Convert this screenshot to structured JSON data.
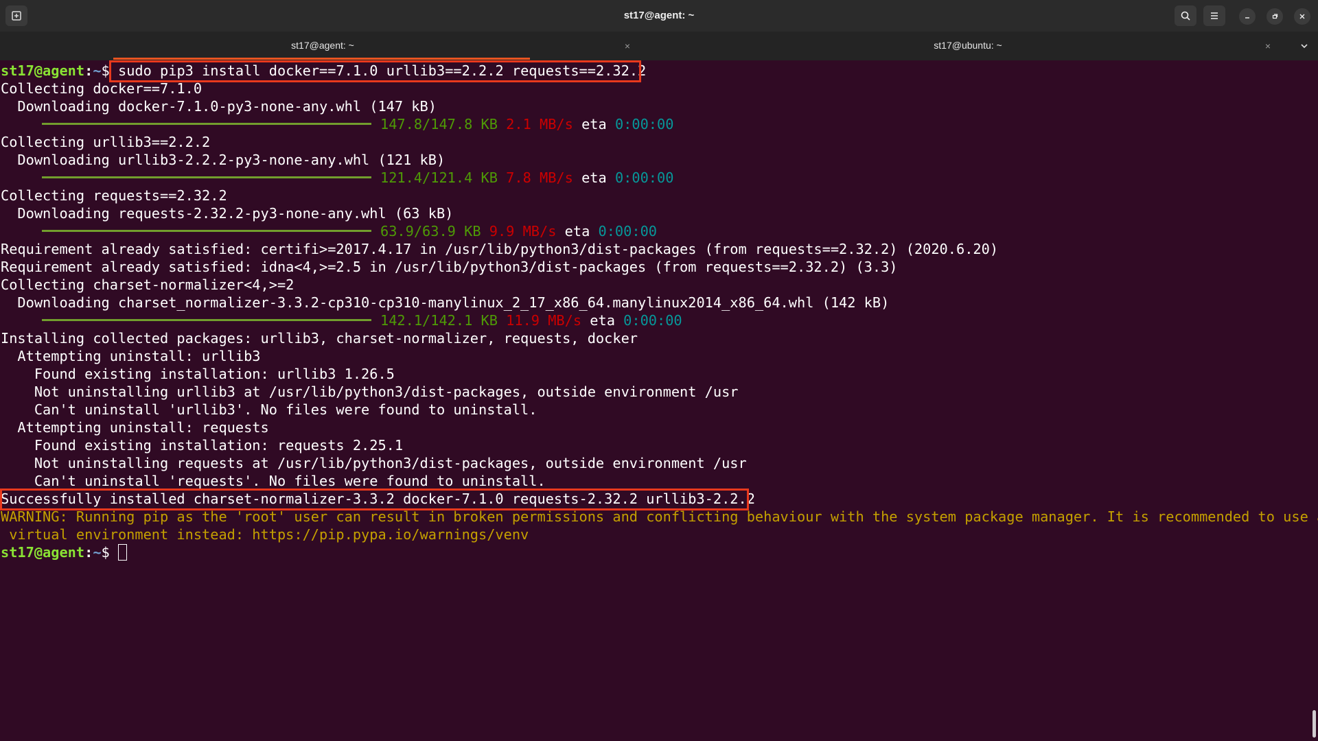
{
  "window": {
    "title": "st17@agent: ~",
    "tabs": [
      {
        "label": "st17@agent: ~",
        "active": true
      },
      {
        "label": "st17@ubuntu: ~",
        "active": false
      }
    ]
  },
  "icons": {
    "new_tab": "new-tab-icon",
    "search": "search-icon",
    "menu": "hamburger-menu-icon",
    "minimize": "minimize-icon",
    "maximize": "maximize-icon",
    "close": "close-icon",
    "tab_close": "×",
    "tab_dropdown": "chevron-down-icon"
  },
  "colors": {
    "terminal_bg": "#300a24",
    "prompt_user": "#8ae234",
    "highlight_box": "#e8391d",
    "progress_bar": "#729e2d"
  },
  "terminal": {
    "prompt": {
      "user": "st17@agent",
      "sep": ":",
      "dir": "~",
      "symbol": "$"
    },
    "command": "sudo pip3 install docker==7.1.0 urllib3==2.2.2 requests==2.32.2",
    "lines": {
      "l1": "Collecting docker==7.1.0",
      "l2": "  Downloading docker-7.1.0-py3-none-any.whl (147 kB)",
      "p1": {
        "size": "147.8/147.8 KB",
        "speed": "2.1 MB/s",
        "eta_label": "eta",
        "eta": "0:00:00"
      },
      "l4": "Collecting urllib3==2.2.2",
      "l5": "  Downloading urllib3-2.2.2-py3-none-any.whl (121 kB)",
      "p2": {
        "size": "121.4/121.4 KB",
        "speed": "7.8 MB/s",
        "eta_label": "eta",
        "eta": "0:00:00"
      },
      "l7": "Collecting requests==2.32.2",
      "l8": "  Downloading requests-2.32.2-py3-none-any.whl (63 kB)",
      "p3": {
        "size": "63.9/63.9 KB",
        "speed": "9.9 MB/s",
        "eta_label": "eta",
        "eta": "0:00:00"
      },
      "l10": "Requirement already satisfied: certifi>=2017.4.17 in /usr/lib/python3/dist-packages (from requests==2.32.2) (2020.6.20)",
      "l11": "Requirement already satisfied: idna<4,>=2.5 in /usr/lib/python3/dist-packages (from requests==2.32.2) (3.3)",
      "l12": "Collecting charset-normalizer<4,>=2",
      "l13": "  Downloading charset_normalizer-3.3.2-cp310-cp310-manylinux_2_17_x86_64.manylinux2014_x86_64.whl (142 kB)",
      "p4": {
        "size": "142.1/142.1 KB",
        "speed": "11.9 MB/s",
        "eta_label": "eta",
        "eta": "0:00:00"
      },
      "l15": "Installing collected packages: urllib3, charset-normalizer, requests, docker",
      "l16": "  Attempting uninstall: urllib3",
      "l17": "    Found existing installation: urllib3 1.26.5",
      "l18": "    Not uninstalling urllib3 at /usr/lib/python3/dist-packages, outside environment /usr",
      "l19": "    Can't uninstall 'urllib3'. No files were found to uninstall.",
      "l20": "  Attempting uninstall: requests",
      "l21": "    Found existing installation: requests 2.25.1",
      "l22": "    Not uninstalling requests at /usr/lib/python3/dist-packages, outside environment /usr",
      "l23": "    Can't uninstall 'requests'. No files were found to uninstall.",
      "l24": "Successfully installed charset-normalizer-3.3.2 docker-7.1.0 requests-2.32.2 urllib3-2.2.2",
      "l25": "WARNING: Running pip as the 'root' user can result in broken permissions and conflicting behaviour with the system package manager. It is recommended to use a",
      "l26": " virtual environment instead: https://pip.pypa.io/warnings/venv"
    }
  }
}
